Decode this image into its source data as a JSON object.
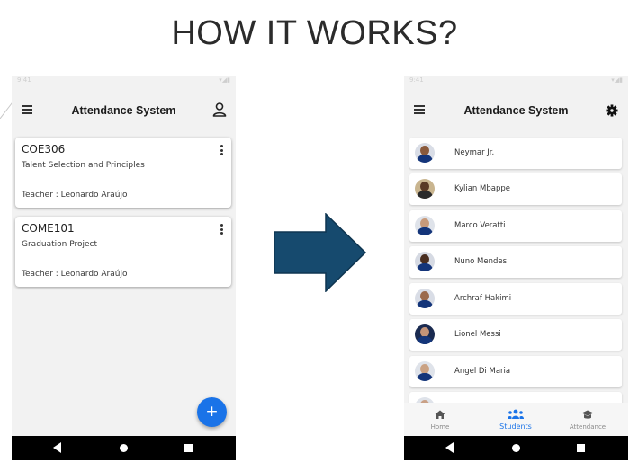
{
  "slide_title": "HOW IT WORKS?",
  "colors": {
    "accent": "#1a73e8",
    "arrow_fill": "#164a6e",
    "arrow_stroke": "#0e3550"
  },
  "phone_a": {
    "status_time": "9:41",
    "app_title": "Attendance System",
    "menu_icon": "hamburger-menu-icon",
    "right_icon": "person-outline-icon",
    "courses": [
      {
        "code": "COE306",
        "name": "Talent Selection and Principles",
        "teacher": "Teacher : Leonardo Araújo"
      },
      {
        "code": "COME101",
        "name": "Graduation Project",
        "teacher": "Teacher : Leonardo Araújo"
      }
    ],
    "fab_label": "+"
  },
  "phone_b": {
    "status_time": "9:41",
    "app_title": "Attendance System",
    "menu_icon": "hamburger-menu-icon",
    "right_icon": "gear-icon",
    "students": [
      {
        "name": "Neymar Jr.",
        "skin": "#8a5a3c"
      },
      {
        "name": "Kylian Mbappe",
        "skin": "#5a3a26"
      },
      {
        "name": "Marco Veratti",
        "skin": "#c89a7a"
      },
      {
        "name": "Nuno Mendes",
        "skin": "#4a2e20"
      },
      {
        "name": "Archraf Hakimi",
        "skin": "#9b6a4c"
      },
      {
        "name": "Lionel Messi",
        "skin": "#c49478"
      },
      {
        "name": "Angel Di Maria",
        "skin": "#caa284"
      },
      {
        "name": "",
        "skin": "#c9a085"
      }
    ],
    "tabs": [
      {
        "label": "Home",
        "icon": "home-icon",
        "active": false
      },
      {
        "label": "Students",
        "icon": "group-icon",
        "active": true
      },
      {
        "label": "Attendance",
        "icon": "graduation-cap-icon",
        "active": false
      }
    ]
  }
}
